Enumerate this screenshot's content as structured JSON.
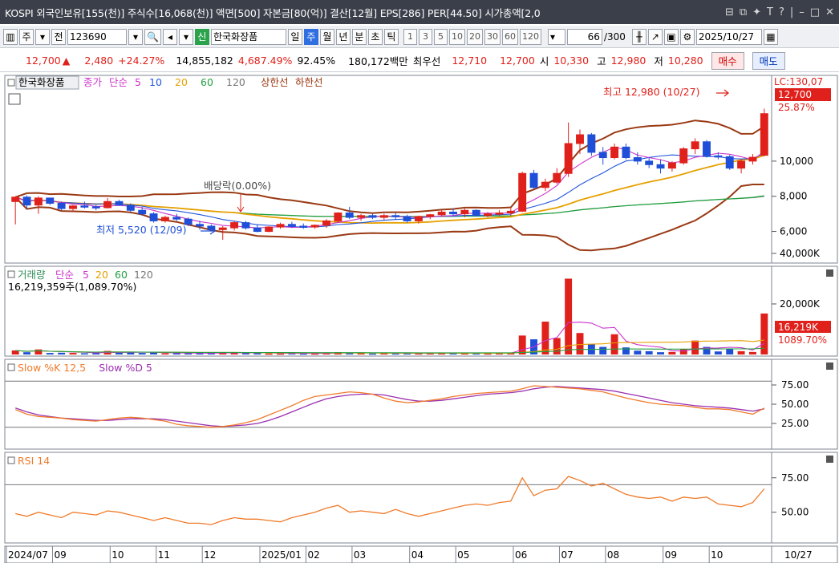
{
  "window": {
    "title": "KOSPI 외국인보유[155(천)] 주식수[16,068(천)] 액면[500] 자본금[80(억)] 결산[12월] EPS[286] PER[44.50] 시가총액[2,0"
  },
  "toolbar": {
    "period_label": "주",
    "view_label": "전",
    "code_value": "123690",
    "new_label": "신",
    "stock_name": "한국화장품",
    "tabs": [
      "일",
      "주",
      "월",
      "년",
      "분",
      "초",
      "틱"
    ],
    "active_tab": "주",
    "intervals": [
      "1",
      "3",
      "5",
      "10",
      "20",
      "30",
      "60",
      "120"
    ],
    "count": "66",
    "count_total": "/300",
    "date": "2025/10/27"
  },
  "quote": {
    "price": "12,700",
    "change_arrow": "▲",
    "change": "2,480",
    "change_pct": "+24.27%",
    "volume": "14,855,182",
    "volume_pct": "4,687.49%",
    "turnover_pct": "92.45%",
    "amount": "180,172백만",
    "best_label": "최우선",
    "best_ask": "12,710",
    "best_bid": "12,700",
    "open_label": "시",
    "open": "10,330",
    "high_label": "고",
    "high": "12,980",
    "low_label": "저",
    "low": "10,280",
    "buy_label": "매수",
    "sell_label": "매도"
  },
  "price_panel": {
    "name_box": "한국화장품",
    "legend": [
      {
        "label": "종가",
        "color": "#cc33cc"
      },
      {
        "label": "단순",
        "color": "#cc33cc"
      },
      {
        "label": "5",
        "color": "#cc33cc"
      },
      {
        "label": "10",
        "color": "#2255dd"
      },
      {
        "label": "20",
        "color": "#e6a000"
      },
      {
        "label": "60",
        "color": "#22a040"
      },
      {
        "label": "120",
        "color": "#777777"
      },
      {
        "label": "상한선",
        "color": "#9a3a14"
      },
      {
        "label": "하한선",
        "color": "#9a3a14"
      }
    ],
    "high_note": "최고 12,980 (10/27)",
    "low_note": "최저 5,520 (12/09)",
    "dividend_note": "배당락(0.00%)",
    "lc_label": "LC:130,07",
    "price_tag": "12,700",
    "pct_tag": "25.87%",
    "y_ticks": [
      "10,000",
      "8,000",
      "6,000"
    ]
  },
  "volume_panel": {
    "legend": [
      {
        "label": "거래량",
        "color": "#2e8b57"
      },
      {
        "label": "단순",
        "color": "#cc33cc"
      },
      {
        "label": "5",
        "color": "#cc33cc"
      },
      {
        "label": "20",
        "color": "#e6a000"
      },
      {
        "label": "60",
        "color": "#22a040"
      },
      {
        "label": "120",
        "color": "#777777"
      }
    ],
    "current": "16,219,359주(1,089.70%)",
    "tag": "16,219K",
    "tag_pct": "1089.70%",
    "y_ticks": [
      "40,000K",
      "20,000K"
    ]
  },
  "stoch_panel": {
    "legend": [
      {
        "label": "Slow %K 12,5",
        "color": "#f07a2a"
      },
      {
        "label": "Slow %D 5",
        "color": "#9a2fb0"
      }
    ],
    "y_ticks": [
      "75.00",
      "50.00",
      "25.00"
    ]
  },
  "rsi_panel": {
    "legend": [
      {
        "label": "RSI 14",
        "color": "#f07a2a"
      }
    ],
    "y_ticks": [
      "75.00",
      "50.00"
    ]
  },
  "x_axis": {
    "labels": [
      "2024/07",
      "09",
      "10",
      "11",
      "12",
      "2025/01",
      "02",
      "03",
      "04",
      "05",
      "06",
      "07",
      "08",
      "09",
      "10"
    ],
    "current_date": "10/27"
  },
  "chart_data": {
    "type": "candlestick",
    "y_unit": "KRW",
    "price_ylim": [
      4200,
      13600
    ],
    "candles": [
      {
        "o": 7700,
        "h": 8000,
        "l": 6400,
        "c": 7950
      },
      {
        "o": 7950,
        "h": 8050,
        "l": 7300,
        "c": 7500
      },
      {
        "o": 7500,
        "h": 8000,
        "l": 7000,
        "c": 7900
      },
      {
        "o": 7900,
        "h": 7900,
        "l": 7500,
        "c": 7600
      },
      {
        "o": 7600,
        "h": 7700,
        "l": 7200,
        "c": 7300
      },
      {
        "o": 7300,
        "h": 7500,
        "l": 7100,
        "c": 7450
      },
      {
        "o": 7450,
        "h": 7700,
        "l": 7300,
        "c": 7400
      },
      {
        "o": 7400,
        "h": 7500,
        "l": 7200,
        "c": 7350
      },
      {
        "o": 7350,
        "h": 7900,
        "l": 7300,
        "c": 7700
      },
      {
        "o": 7700,
        "h": 7800,
        "l": 7450,
        "c": 7500
      },
      {
        "o": 7500,
        "h": 7600,
        "l": 7100,
        "c": 7200
      },
      {
        "o": 7200,
        "h": 7400,
        "l": 6900,
        "c": 7000
      },
      {
        "o": 7000,
        "h": 7100,
        "l": 6500,
        "c": 6600
      },
      {
        "o": 6600,
        "h": 6900,
        "l": 6500,
        "c": 6800
      },
      {
        "o": 6800,
        "h": 7000,
        "l": 6600,
        "c": 6700
      },
      {
        "o": 6700,
        "h": 6800,
        "l": 6300,
        "c": 6400
      },
      {
        "o": 6400,
        "h": 6600,
        "l": 6100,
        "c": 6300
      },
      {
        "o": 6300,
        "h": 6400,
        "l": 6000,
        "c": 6100
      },
      {
        "o": 6100,
        "h": 6300,
        "l": 5520,
        "c": 6200
      },
      {
        "o": 6200,
        "h": 6600,
        "l": 6050,
        "c": 6500
      },
      {
        "o": 6500,
        "h": 6600,
        "l": 6100,
        "c": 6200
      },
      {
        "o": 6200,
        "h": 6400,
        "l": 5950,
        "c": 6000
      },
      {
        "o": 6000,
        "h": 6300,
        "l": 5950,
        "c": 6250
      },
      {
        "o": 6250,
        "h": 6500,
        "l": 6150,
        "c": 6400
      },
      {
        "o": 6400,
        "h": 6550,
        "l": 6200,
        "c": 6300
      },
      {
        "o": 6300,
        "h": 6450,
        "l": 6150,
        "c": 6250
      },
      {
        "o": 6250,
        "h": 6400,
        "l": 6150,
        "c": 6350
      },
      {
        "o": 6350,
        "h": 6700,
        "l": 6200,
        "c": 6600
      },
      {
        "o": 6600,
        "h": 7100,
        "l": 6500,
        "c": 7050
      },
      {
        "o": 7050,
        "h": 7400,
        "l": 6700,
        "c": 6800
      },
      {
        "o": 6800,
        "h": 7000,
        "l": 6600,
        "c": 6900
      },
      {
        "o": 6900,
        "h": 7000,
        "l": 6700,
        "c": 6800
      },
      {
        "o": 6800,
        "h": 7000,
        "l": 6650,
        "c": 6900
      },
      {
        "o": 6900,
        "h": 7050,
        "l": 6700,
        "c": 6850
      },
      {
        "o": 6850,
        "h": 6950,
        "l": 6500,
        "c": 6600
      },
      {
        "o": 6600,
        "h": 6900,
        "l": 6450,
        "c": 6850
      },
      {
        "o": 6850,
        "h": 7000,
        "l": 6700,
        "c": 6950
      },
      {
        "o": 6950,
        "h": 7200,
        "l": 6850,
        "c": 7100
      },
      {
        "o": 7100,
        "h": 7300,
        "l": 6900,
        "c": 7000
      },
      {
        "o": 7000,
        "h": 7300,
        "l": 6800,
        "c": 7200
      },
      {
        "o": 7200,
        "h": 7250,
        "l": 6850,
        "c": 6900
      },
      {
        "o": 6900,
        "h": 7100,
        "l": 6800,
        "c": 7000
      },
      {
        "o": 7000,
        "h": 7200,
        "l": 6900,
        "c": 7050
      },
      {
        "o": 7050,
        "h": 7300,
        "l": 6900,
        "c": 7150
      },
      {
        "o": 7150,
        "h": 9400,
        "l": 7100,
        "c": 9300
      },
      {
        "o": 9300,
        "h": 9500,
        "l": 8400,
        "c": 8500
      },
      {
        "o": 8500,
        "h": 9000,
        "l": 8300,
        "c": 8800
      },
      {
        "o": 8800,
        "h": 9600,
        "l": 8700,
        "c": 9300
      },
      {
        "o": 9300,
        "h": 12200,
        "l": 9100,
        "c": 11000
      },
      {
        "o": 11000,
        "h": 11800,
        "l": 10400,
        "c": 11500
      },
      {
        "o": 11500,
        "h": 11600,
        "l": 10300,
        "c": 10500
      },
      {
        "o": 10500,
        "h": 10800,
        "l": 9800,
        "c": 10200
      },
      {
        "o": 10200,
        "h": 11000,
        "l": 10100,
        "c": 10800
      },
      {
        "o": 10800,
        "h": 11000,
        "l": 10100,
        "c": 10200
      },
      {
        "o": 10200,
        "h": 10500,
        "l": 9800,
        "c": 10000
      },
      {
        "o": 10000,
        "h": 10200,
        "l": 9600,
        "c": 9800
      },
      {
        "o": 9800,
        "h": 10100,
        "l": 9300,
        "c": 9600
      },
      {
        "o": 9600,
        "h": 10000,
        "l": 9400,
        "c": 9900
      },
      {
        "o": 9900,
        "h": 10800,
        "l": 9800,
        "c": 10700
      },
      {
        "o": 10700,
        "h": 11300,
        "l": 10400,
        "c": 11100
      },
      {
        "o": 11100,
        "h": 11200,
        "l": 10200,
        "c": 10300
      },
      {
        "o": 10300,
        "h": 10500,
        "l": 10100,
        "c": 10250
      },
      {
        "o": 10250,
        "h": 10350,
        "l": 9500,
        "c": 9600
      },
      {
        "o": 9600,
        "h": 10100,
        "l": 9300,
        "c": 10000
      },
      {
        "o": 10000,
        "h": 10400,
        "l": 9800,
        "c": 10220
      },
      {
        "o": 10330,
        "h": 12980,
        "l": 10280,
        "c": 12700
      }
    ],
    "volume_k": [
      1600,
      900,
      2000,
      600,
      700,
      600,
      500,
      700,
      1400,
      700,
      1000,
      600,
      800,
      500,
      500,
      500,
      500,
      600,
      900,
      800,
      500,
      500,
      400,
      400,
      500,
      400,
      400,
      600,
      900,
      700,
      500,
      400,
      500,
      450,
      500,
      450,
      500,
      600,
      500,
      500,
      600,
      450,
      500,
      500,
      7500,
      6000,
      13000,
      6500,
      30000,
      8500,
      4000,
      3000,
      8000,
      2800,
      1500,
      1300,
      900,
      1000,
      2200,
      5500,
      3000,
      1200,
      2400,
      1300,
      1000,
      16219
    ],
    "stoch_k": [
      43,
      37,
      34,
      33,
      32,
      30,
      29,
      28,
      30,
      32,
      33,
      32,
      30,
      28,
      24,
      22,
      21,
      20,
      21,
      23,
      26,
      30,
      36,
      42,
      48,
      55,
      60,
      62,
      64,
      66,
      65,
      63,
      58,
      54,
      52,
      53,
      55,
      57,
      60,
      62,
      64,
      65,
      66,
      67,
      70,
      74,
      73,
      72,
      71,
      70,
      68,
      66,
      62,
      58,
      55,
      52,
      50,
      49,
      48,
      46,
      44,
      44,
      43,
      40,
      37,
      45
    ],
    "stoch_d": [
      45,
      40,
      36,
      34,
      32,
      31,
      30,
      29,
      29,
      30,
      31,
      31,
      31,
      30,
      28,
      26,
      24,
      22,
      21,
      22,
      23,
      25,
      29,
      34,
      40,
      46,
      52,
      57,
      60,
      62,
      63,
      63,
      62,
      59,
      56,
      54,
      54,
      55,
      57,
      59,
      61,
      63,
      64,
      65,
      67,
      70,
      72,
      73,
      72,
      71,
      70,
      69,
      67,
      64,
      61,
      58,
      55,
      52,
      50,
      48,
      47,
      46,
      45,
      43,
      41,
      44
    ],
    "rsi": [
      49,
      47,
      50,
      48,
      46,
      50,
      49,
      48,
      51,
      50,
      48,
      46,
      44,
      46,
      44,
      42,
      42,
      41,
      44,
      46,
      45,
      45,
      44,
      43,
      46,
      48,
      50,
      53,
      55,
      50,
      51,
      50,
      49,
      52,
      49,
      47,
      49,
      51,
      53,
      55,
      56,
      55,
      57,
      58,
      75,
      62,
      66,
      67,
      76,
      73,
      69,
      71,
      67,
      63,
      61,
      60,
      61,
      58,
      61,
      60,
      61,
      56,
      55,
      54,
      57,
      67
    ]
  }
}
